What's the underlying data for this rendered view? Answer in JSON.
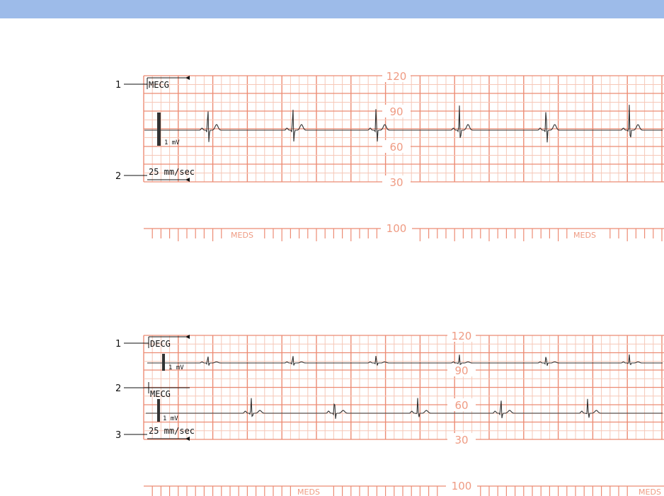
{
  "colors": {
    "header_bar": "#9dbbe9",
    "grid_minor": "#f6c8b8",
    "grid_major": "#ec8c74",
    "scale_label": "#ef9b83",
    "trace": "#333333",
    "annotation": "#111111"
  },
  "chart_data": [
    {
      "type": "line",
      "strip_scale": {
        "ticks": [
          120,
          90,
          60,
          30
        ],
        "lower_label": "100"
      },
      "meds_labels": [
        "MEDS",
        "MEDS"
      ],
      "speed_label": "25 mm/sec",
      "callouts": [
        "1",
        "2"
      ],
      "series": [
        {
          "lead_label": "MECG",
          "calibration_label": "1 mV",
          "beat_times_s": [
            1.85,
            4.3,
            6.7,
            9.1,
            11.6,
            14.0
          ]
        }
      ]
    },
    {
      "type": "line",
      "strip_scale": {
        "ticks": [
          120,
          90,
          60,
          30
        ],
        "lower_label": "100"
      },
      "meds_labels": [
        "MEDS",
        "MEDS"
      ],
      "speed_label": "25 mm/sec",
      "callouts": [
        "1",
        "2",
        "3"
      ],
      "series": [
        {
          "lead_label": "DECG",
          "calibration_label": "1 mV",
          "beat_times_s": [
            1.85,
            4.3,
            6.7,
            9.1,
            11.6,
            14.0
          ]
        },
        {
          "lead_label": "MECG",
          "calibration_label": "1 mV",
          "beat_times_s": [
            3.1,
            5.5,
            7.9,
            10.3,
            12.8
          ]
        }
      ]
    }
  ]
}
